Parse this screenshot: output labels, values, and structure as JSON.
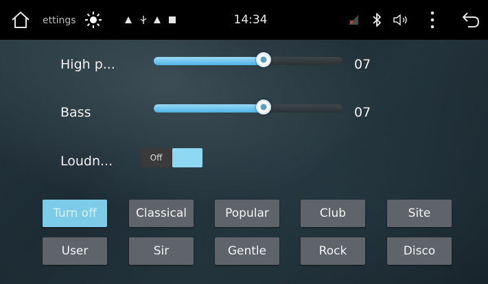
{
  "status_bar": {
    "settings_label": "ettings",
    "clock": "14:34",
    "icons": {
      "home": "home-icon",
      "brightness": "brightness-icon",
      "warning": "warning-icon",
      "usb": "usb-icon",
      "stop": "stop-icon",
      "signal": "signal-icon",
      "bluetooth": "bluetooth-icon",
      "volume": "volume-icon",
      "menu": "more-vertical-icon",
      "back": "back-icon"
    }
  },
  "settings": {
    "high_pitch": {
      "label": "High p...",
      "value": "07",
      "level": 7,
      "max": 12
    },
    "bass": {
      "label": "Bass",
      "value": "07",
      "level": 7,
      "max": 12
    },
    "loudness": {
      "label": "Loudn...",
      "state_text": "Off"
    }
  },
  "eq_presets": {
    "row1": [
      {
        "label": "Turn off",
        "active": true
      },
      {
        "label": "Classical",
        "active": false
      },
      {
        "label": "Popular",
        "active": false
      },
      {
        "label": "Club",
        "active": false
      },
      {
        "label": "Site",
        "active": false
      }
    ],
    "row2": [
      {
        "label": "User",
        "active": false
      },
      {
        "label": "Sir",
        "active": false
      },
      {
        "label": "Gentle",
        "active": false
      },
      {
        "label": "Rock",
        "active": false
      },
      {
        "label": "Disco",
        "active": false
      }
    ]
  },
  "colors": {
    "accent": "#7ccbe8",
    "slider_fill": "#4fb4e6",
    "button_bg": "#5e6469",
    "status_bar_bg": "#000000"
  }
}
